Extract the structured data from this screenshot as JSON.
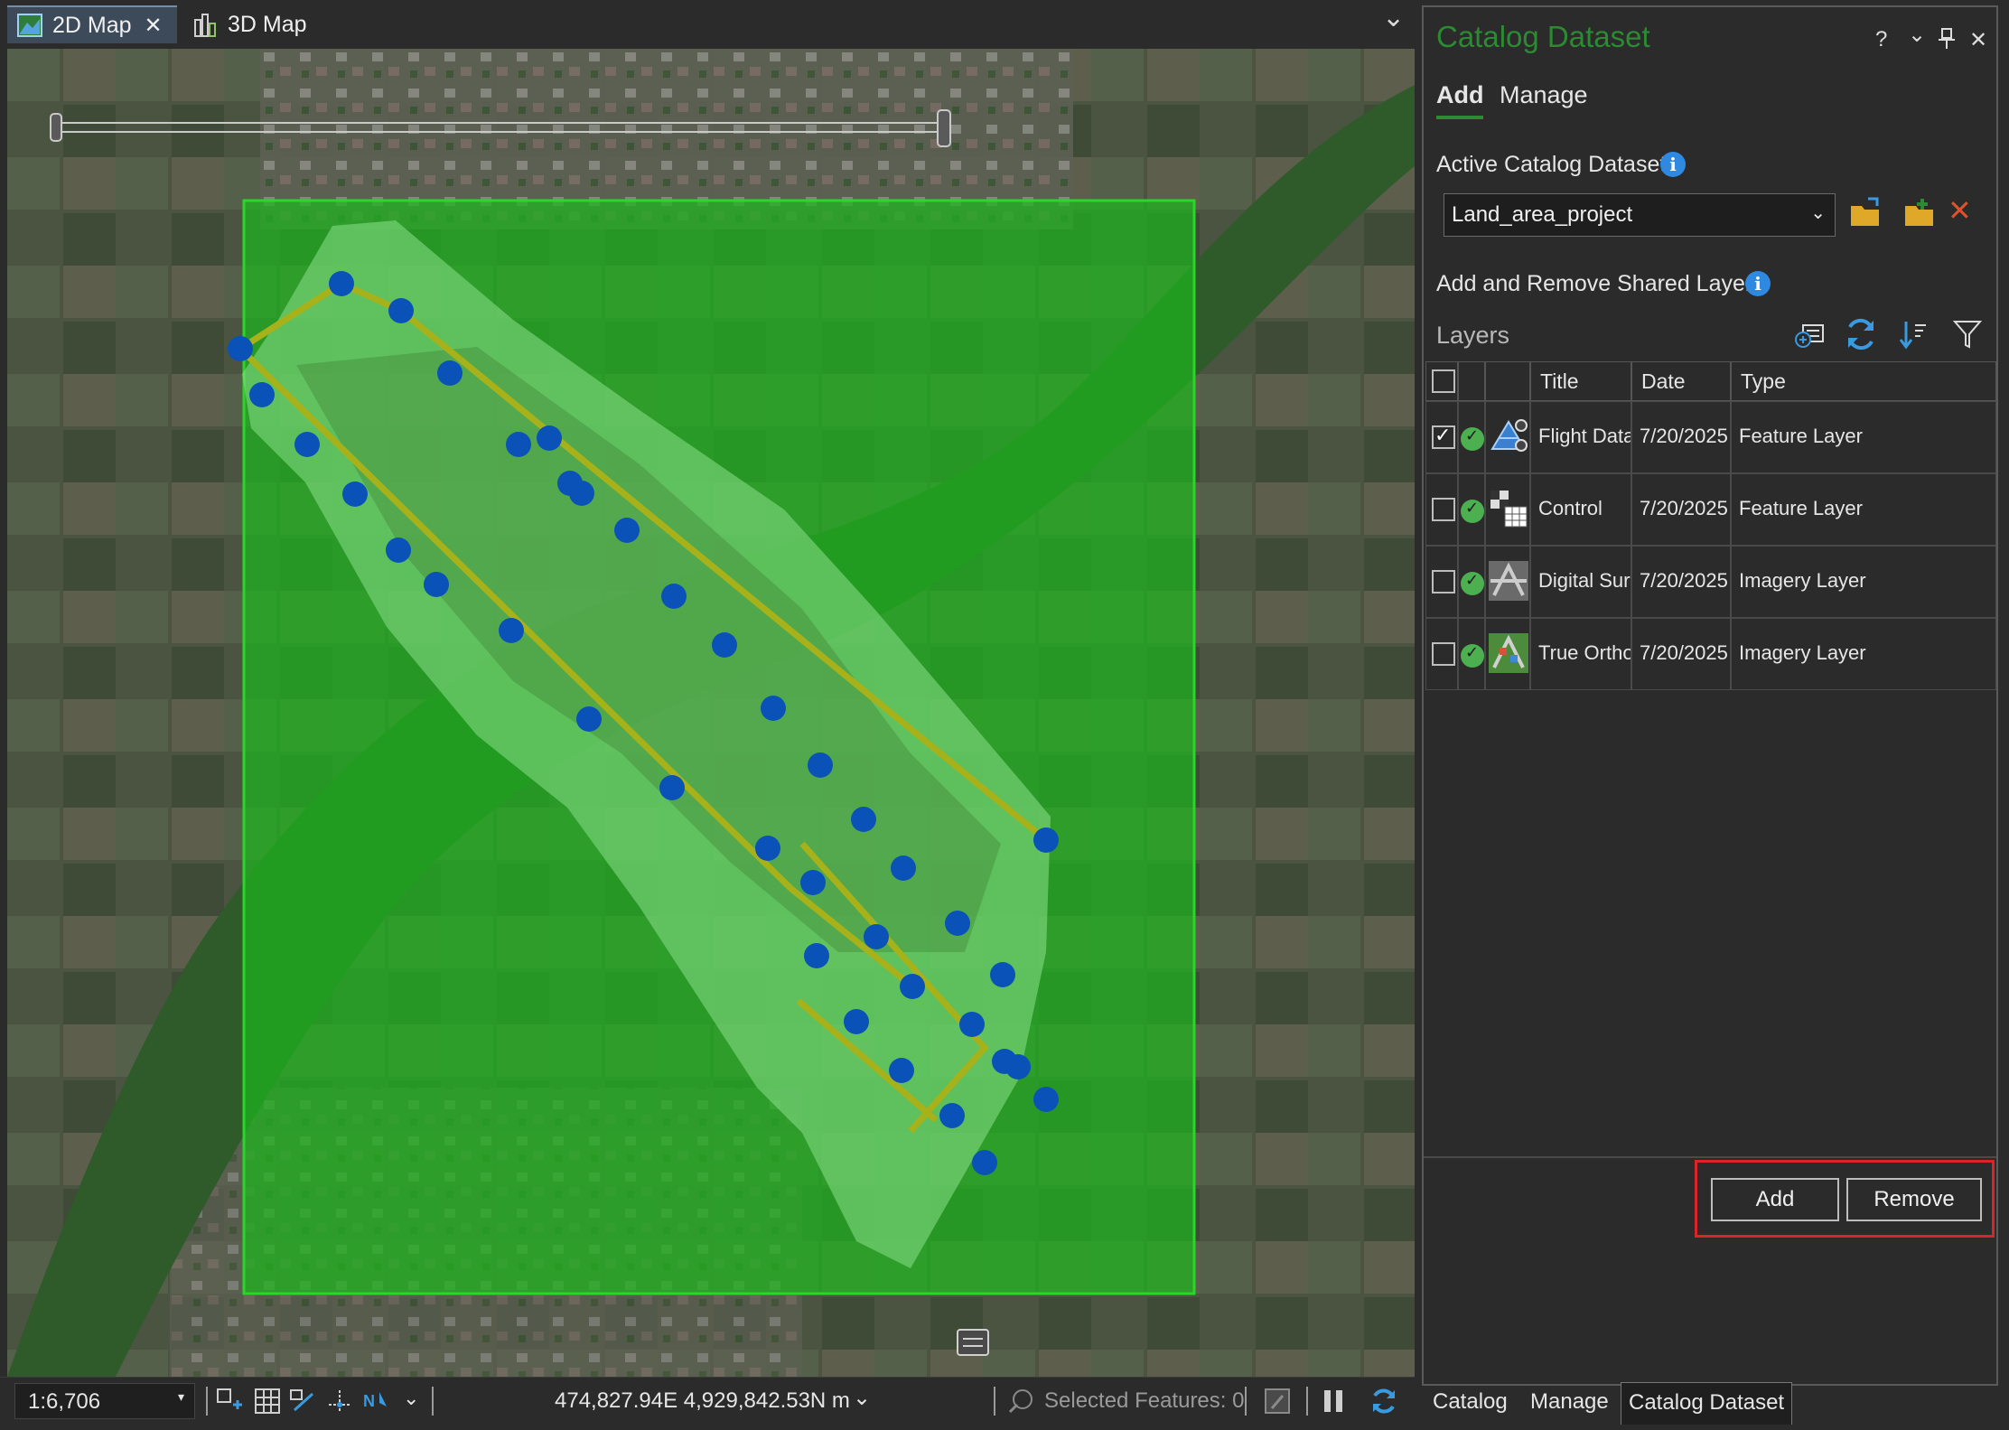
{
  "map_tabs": [
    {
      "label": "2D Map",
      "icon": "map-2d-icon",
      "active": true
    },
    {
      "label": "3D Map",
      "icon": "map-3d-icon",
      "active": false
    }
  ],
  "map": {
    "close_glyph": "✕",
    "dropdown_glyph": "⌄",
    "accent_extent_color": "#2bd62b",
    "flight_line_color": "#a7b21a",
    "flight_point_color": "#0a52b8"
  },
  "status_bar": {
    "scale": "1:6,706",
    "coordinates": "474,827.94E 4,929,842.53N m",
    "selected_features": "Selected Features: 0"
  },
  "panel": {
    "title": "Catalog Dataset",
    "header_icons": [
      "help-icon",
      "menu-chevron-icon",
      "pin-icon",
      "close-icon"
    ],
    "header_glyphs": {
      "help": "?",
      "menu": "⌄",
      "pin": "⊥",
      "close": "✕"
    },
    "tabs": [
      "Add",
      "Manage"
    ],
    "active_dataset_label": "Active Catalog Dataset",
    "active_dataset_value": "Land_area_project",
    "shared_layers_label": "Add and Remove Shared Layers",
    "layers_label": "Layers",
    "columns": [
      "Title",
      "Date",
      "Type"
    ],
    "layers": [
      {
        "title": "Flight Data",
        "date": "7/20/2025",
        "type": "Feature Layer",
        "checked": true,
        "icon": "flight-data-icon"
      },
      {
        "title": "Control",
        "date": "7/20/2025",
        "type": "Feature Layer",
        "checked": false,
        "icon": "control-points-icon"
      },
      {
        "title": "Digital Surface",
        "date": "7/20/2025",
        "type": "Imagery Layer",
        "checked": false,
        "icon": "digital-surface-icon"
      },
      {
        "title": "True Ortho",
        "date": "7/20/2025",
        "type": "Imagery Layer",
        "checked": false,
        "icon": "true-ortho-icon"
      }
    ],
    "add_button": "Add",
    "remove_button": "Remove",
    "bottom_tabs": [
      "Catalog",
      "Manage",
      "Catalog Dataset"
    ],
    "accent_color": "#2c8a32"
  }
}
